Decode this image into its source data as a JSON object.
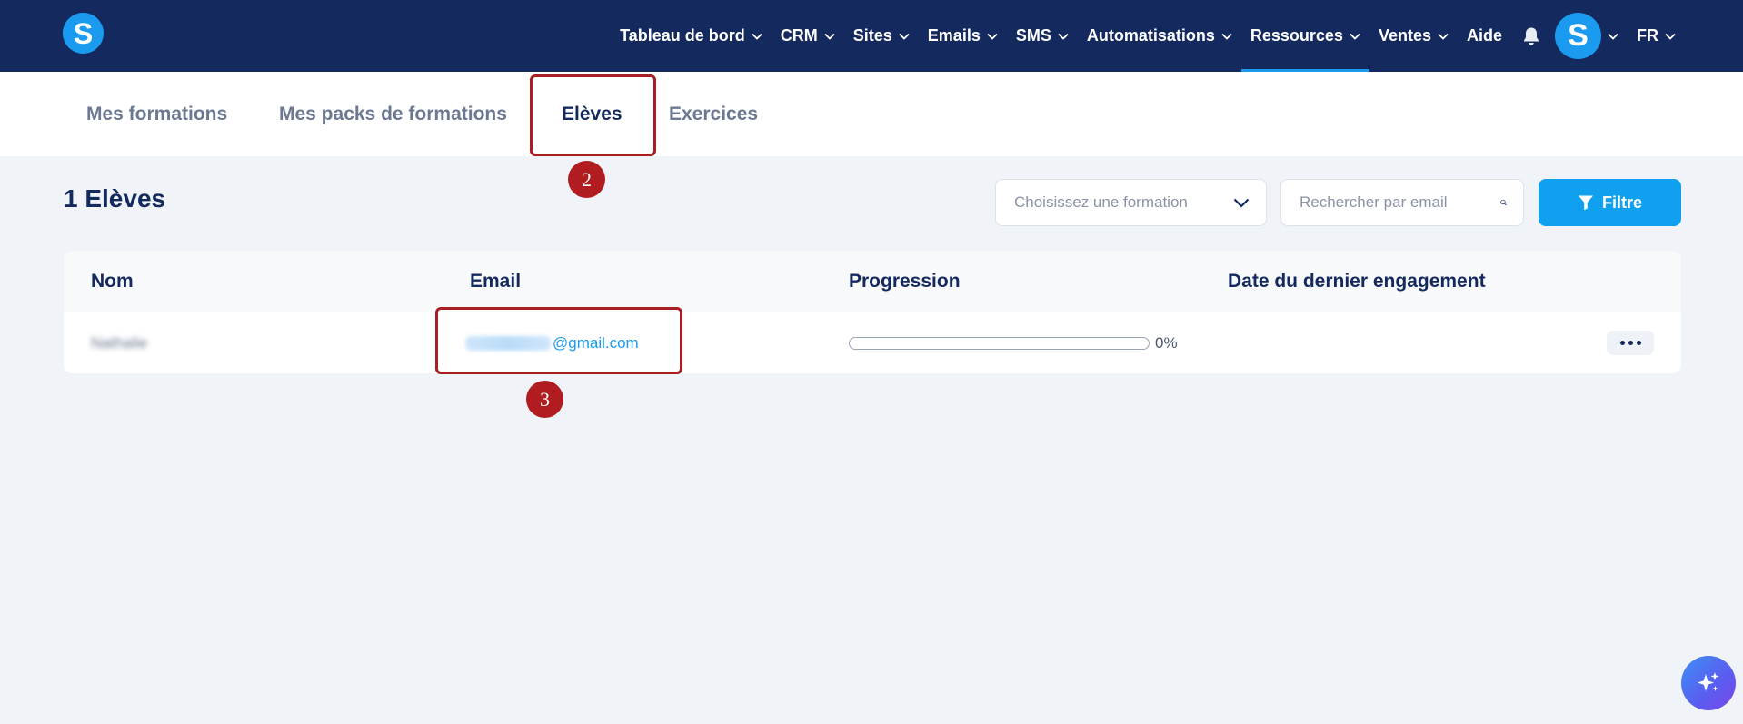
{
  "nav": {
    "logo_letter": "S",
    "items": [
      {
        "label": "Tableau de bord"
      },
      {
        "label": "CRM"
      },
      {
        "label": "Sites"
      },
      {
        "label": "Emails"
      },
      {
        "label": "SMS"
      },
      {
        "label": "Automatisations"
      },
      {
        "label": "Ressources"
      },
      {
        "label": "Ventes"
      }
    ],
    "active_item": "Ressources",
    "help_label": "Aide",
    "avatar_letter": "S",
    "language": "FR",
    "icons": {
      "bell": "bell-icon",
      "chevron": "chevron-down-icon"
    }
  },
  "tabs": [
    {
      "label": "Mes formations"
    },
    {
      "label": "Mes packs de formations"
    },
    {
      "label": "Elèves"
    },
    {
      "label": "Exercices"
    }
  ],
  "active_tab": "Elèves",
  "annotations": {
    "tab_marker": "2",
    "email_marker": "3"
  },
  "header": {
    "count_title": "1 Elèves",
    "formation_select_placeholder": "Choisissez une formation",
    "search_placeholder": "Rechercher par email",
    "filter_label": "Filtre"
  },
  "table": {
    "columns": [
      "Nom",
      "Email",
      "Progression",
      "Date du dernier engagement"
    ],
    "rows": [
      {
        "name": "Nathalie",
        "email_domain": "@gmail.com",
        "progress_text": "0%",
        "progress_value": 0,
        "last_engagement": ""
      }
    ]
  },
  "colors": {
    "nav_bg": "#142a5f",
    "accent": "#1a9bf0",
    "annotation": "#a81e22"
  }
}
